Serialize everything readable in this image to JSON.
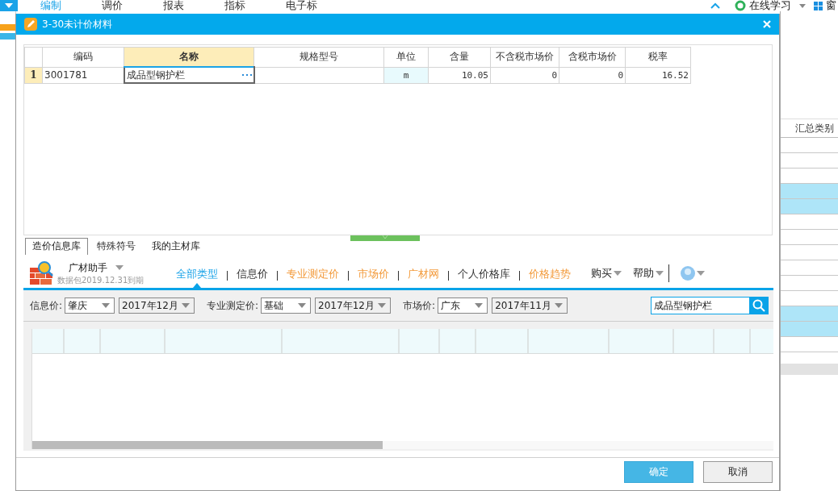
{
  "app_menu": [
    {
      "label": "编制",
      "selected": true
    },
    {
      "label": "调价",
      "selected": false
    },
    {
      "label": "报表",
      "selected": false
    },
    {
      "label": "指标",
      "selected": false
    },
    {
      "label": "电子标",
      "selected": false
    }
  ],
  "app_right": {
    "online_learning": "在线学习",
    "window_menu": "窗"
  },
  "background_table": {
    "columns": [
      "汇总类别"
    ],
    "rows": [
      {
        "selected": false
      },
      {
        "selected": false
      },
      {
        "selected": false
      },
      {
        "selected": true
      },
      {
        "selected": true
      },
      {
        "selected": false
      },
      {
        "selected": false
      },
      {
        "selected": false
      },
      {
        "selected": false
      },
      {
        "selected": false
      },
      {
        "selected": false
      },
      {
        "selected": true
      },
      {
        "selected": true
      },
      {
        "selected": false
      }
    ]
  },
  "dialog": {
    "title": "3-30未计价材料"
  },
  "materials": {
    "columns": [
      {
        "label": "编码",
        "selected": false
      },
      {
        "label": "名称",
        "selected": true
      },
      {
        "label": "规格型号",
        "selected": false
      },
      {
        "label": "单位",
        "selected": false
      },
      {
        "label": "含量",
        "selected": false
      },
      {
        "label": "不含税市场价",
        "selected": false
      },
      {
        "label": "含税市场价",
        "selected": false
      },
      {
        "label": "税率",
        "selected": false
      }
    ],
    "rows": [
      {
        "index": "1",
        "code": "3001781",
        "name": "成品型钢护栏",
        "unit": "m",
        "quantity": "10.05",
        "price_ex_tax": "0",
        "price_inc_tax": "0",
        "tax_rate": "16.52",
        "editing": true
      }
    ]
  },
  "tabs": [
    {
      "label": "造价信息库",
      "selected": true
    },
    {
      "label": "特殊符号",
      "selected": false
    },
    {
      "label": "我的主材库",
      "selected": false
    }
  ],
  "assistant": {
    "title": "广材助手",
    "package_note": "数据包2019.12.31到期"
  },
  "nav": [
    {
      "label": "全部类型",
      "selected": true,
      "color": "#1aa3e8"
    },
    {
      "label": "信息价",
      "selected": false,
      "color": "#333333"
    },
    {
      "label": "专业测定价",
      "selected": false,
      "color": "#f39b3c"
    },
    {
      "label": "市场价",
      "selected": false,
      "color": "#f39b3c"
    },
    {
      "label": "广材网",
      "selected": false,
      "color": "#f39b3c"
    },
    {
      "label": "个人价格库",
      "selected": false,
      "color": "#333333"
    },
    {
      "label": "价格趋势",
      "selected": false,
      "color": "#f39b3c"
    }
  ],
  "menus": [
    {
      "label": "购买"
    },
    {
      "label": "帮助"
    }
  ],
  "filters": [
    {
      "label": "信息价:",
      "selects": [
        {
          "kind": "region",
          "value": "肇庆"
        },
        {
          "kind": "period",
          "value": "2017年12月"
        }
      ]
    },
    {
      "label": "专业测定价:",
      "selects": [
        {
          "kind": "region",
          "value": "基础"
        },
        {
          "kind": "period",
          "value": "2017年12月"
        }
      ]
    },
    {
      "label": "市场价:",
      "selects": [
        {
          "kind": "region",
          "value": "广东"
        },
        {
          "kind": "period",
          "value": "2017年11月"
        }
      ]
    }
  ],
  "search": {
    "value": "成品型钢护栏"
  },
  "buttons": [
    {
      "label": "确定",
      "kind": "primary"
    },
    {
      "label": "取消",
      "kind": "secondary"
    }
  ]
}
